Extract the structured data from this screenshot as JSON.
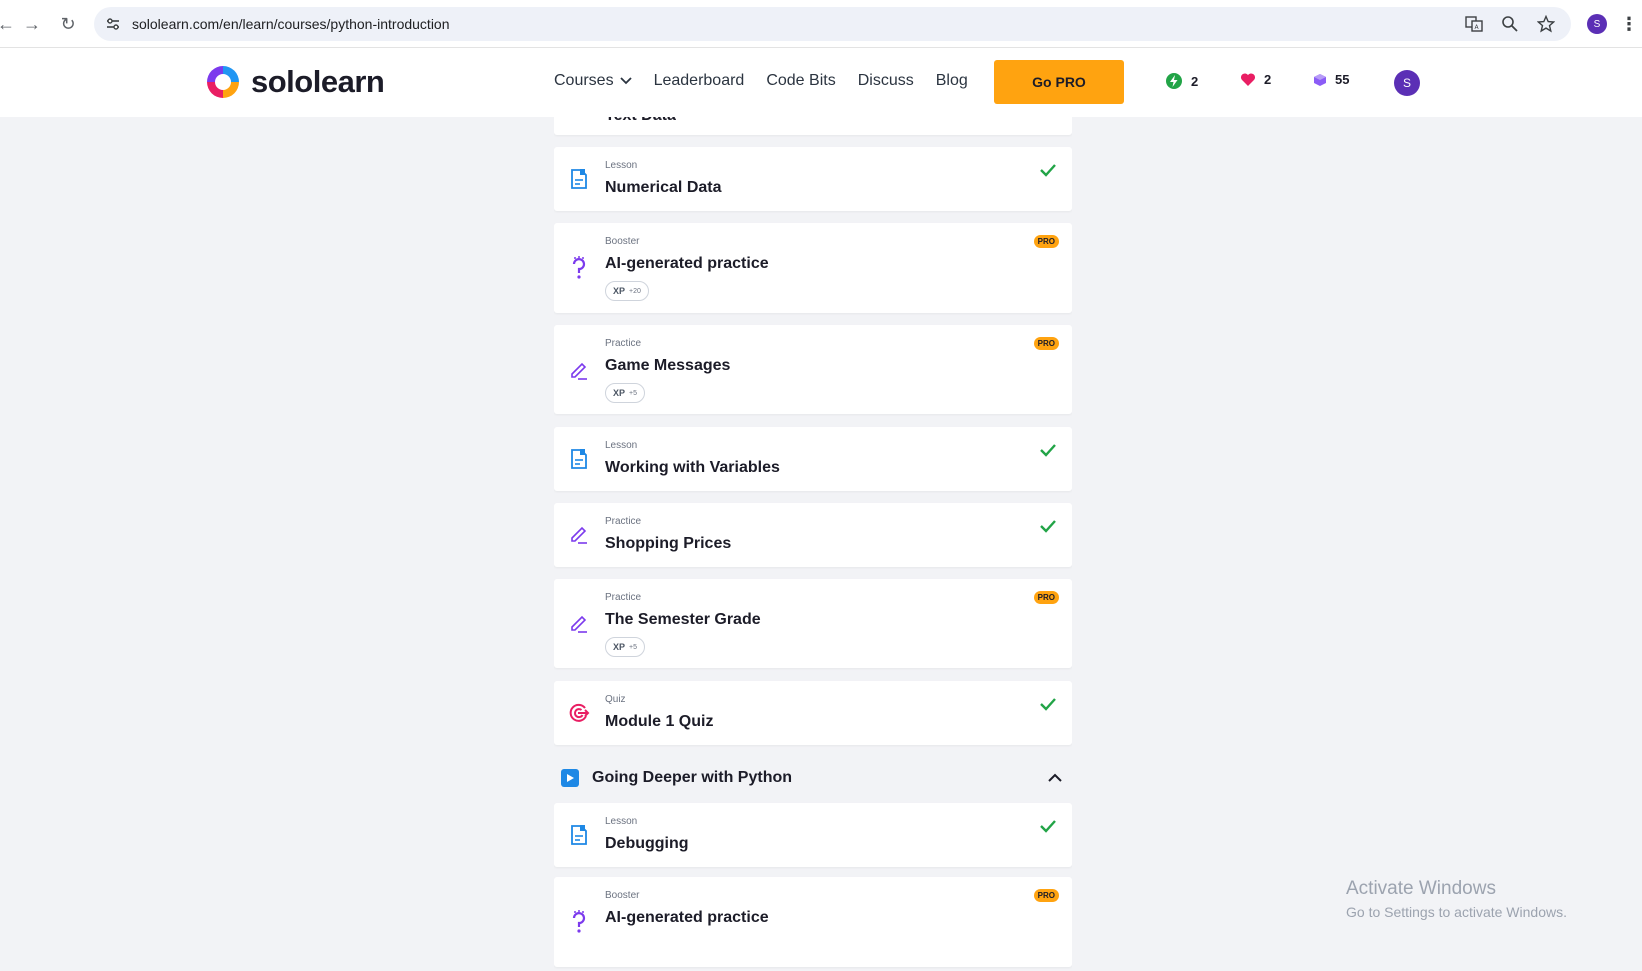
{
  "browser": {
    "url": "sololearn.com/en/learn/courses/python-introduction",
    "profile_initial": "S"
  },
  "header": {
    "brand": "sololearn",
    "nav": {
      "courses": "Courses",
      "leaderboard": "Leaderboard",
      "code_bits": "Code Bits",
      "discuss": "Discuss",
      "blog": "Blog"
    },
    "go_pro": "Go PRO",
    "stats": {
      "streak": "2",
      "hearts": "2",
      "bits": "55"
    },
    "avatar_initial": "S",
    "colors": {
      "accent": "#ffa310",
      "avatar": "#5b2fb5"
    }
  },
  "lessons": {
    "partial_title": "Text Data",
    "items": [
      {
        "type": "Lesson",
        "title": "Numerical Data",
        "status": "completed"
      },
      {
        "type": "Booster",
        "title": "AI-generated practice",
        "badge": "PRO",
        "xp_label": "XP",
        "xp_value": "+20"
      },
      {
        "type": "Practice",
        "title": "Game Messages",
        "badge": "PRO",
        "xp_label": "XP",
        "xp_value": "+5"
      },
      {
        "type": "Lesson",
        "title": "Working with Variables",
        "status": "completed"
      },
      {
        "type": "Practice",
        "title": "Shopping Prices",
        "status": "completed"
      },
      {
        "type": "Practice",
        "title": "The Semester Grade",
        "badge": "PRO",
        "xp_label": "XP",
        "xp_value": "+5"
      },
      {
        "type": "Quiz",
        "title": "Module 1 Quiz",
        "status": "completed"
      }
    ],
    "module": "Going Deeper with Python",
    "module_items": [
      {
        "type": "Lesson",
        "title": "Debugging",
        "status": "completed"
      },
      {
        "type": "Booster",
        "title": "AI-generated practice",
        "badge": "PRO"
      }
    ]
  },
  "watermark": {
    "line1": "Activate Windows",
    "line2": "Go to Settings to activate Windows."
  }
}
